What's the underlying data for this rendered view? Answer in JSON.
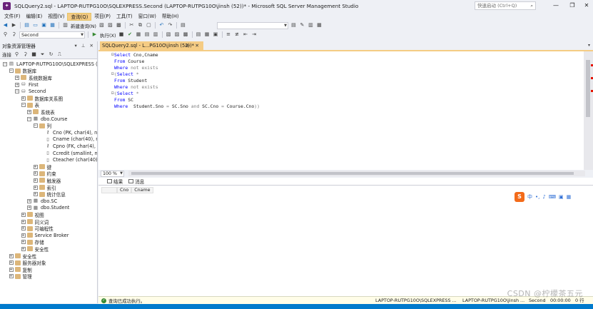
{
  "window": {
    "title": "SQLQuery2.sql - LAPTOP-RUTPG10O\\SQLEXPRESS.Second (LAPTOP-RUTPG10O\\jinsh (52))* - Microsoft SQL Server Management Studio",
    "quick_launch_placeholder": "快速启动 (Ctrl+Q)",
    "controls": {
      "minimize": "—",
      "restore": "❐",
      "close": "✕"
    }
  },
  "menu": [
    "文件(F)",
    "编辑(E)",
    "视图(V)",
    "查询(Q)",
    "项目(P)",
    "工具(T)",
    "窗口(W)",
    "帮助(H)"
  ],
  "toolbar": {
    "new_query": "新建查询(N)",
    "database_select": "Second",
    "execute": "执行(X)"
  },
  "object_explorer": {
    "title": "对象资源管理器",
    "connect": "连接",
    "tree": [
      {
        "label": "LAPTOP-RUTPG10O\\SQLEXPRESS (SC",
        "level": 0,
        "expanded": "−",
        "icon": "server-icon"
      },
      {
        "label": "数据库",
        "level": 1,
        "expanded": "−",
        "icon": "folder-icon"
      },
      {
        "label": "系统数据库",
        "level": 2,
        "expanded": "+",
        "icon": "folder-icon"
      },
      {
        "label": "First",
        "level": 2,
        "expanded": "+",
        "icon": "database-icon"
      },
      {
        "label": "Second",
        "level": 2,
        "expanded": "−",
        "icon": "database-icon"
      },
      {
        "label": "数据库关系图",
        "level": 3,
        "expanded": "+",
        "icon": "folder-icon"
      },
      {
        "label": "表",
        "level": 3,
        "expanded": "−",
        "icon": "folder-icon"
      },
      {
        "label": "系统表",
        "level": 4,
        "expanded": "+",
        "icon": "folder-icon"
      },
      {
        "label": "dbo.Course",
        "level": 4,
        "expanded": "−",
        "icon": "table-icon"
      },
      {
        "label": "列",
        "level": 5,
        "expanded": "−",
        "icon": "folder-icon"
      },
      {
        "label": "Cno (PK, char(4), not",
        "level": 6,
        "expanded": "",
        "icon": "key-icon"
      },
      {
        "label": "Cname (char(40), not",
        "level": 6,
        "expanded": "",
        "icon": "column-icon"
      },
      {
        "label": "Cpno (FK, char(4), null",
        "level": 6,
        "expanded": "",
        "icon": "key-icon"
      },
      {
        "label": "Ccredit (smallint, null",
        "level": 6,
        "expanded": "",
        "icon": "column-icon"
      },
      {
        "label": "Cteacher (char(40), n",
        "level": 6,
        "expanded": "",
        "icon": "column-icon"
      },
      {
        "label": "键",
        "level": 5,
        "expanded": "+",
        "icon": "folder-icon"
      },
      {
        "label": "约束",
        "level": 5,
        "expanded": "+",
        "icon": "folder-icon"
      },
      {
        "label": "触发器",
        "level": 5,
        "expanded": "+",
        "icon": "folder-icon"
      },
      {
        "label": "索引",
        "level": 5,
        "expanded": "+",
        "icon": "folder-icon"
      },
      {
        "label": "统计信息",
        "level": 5,
        "expanded": "+",
        "icon": "folder-icon"
      },
      {
        "label": "dbo.SC",
        "level": 4,
        "expanded": "+",
        "icon": "table-icon"
      },
      {
        "label": "dbo.Student",
        "level": 4,
        "expanded": "+",
        "icon": "table-icon"
      },
      {
        "label": "视图",
        "level": 3,
        "expanded": "+",
        "icon": "folder-icon"
      },
      {
        "label": "同义词",
        "level": 3,
        "expanded": "+",
        "icon": "folder-icon"
      },
      {
        "label": "可编程性",
        "level": 3,
        "expanded": "+",
        "icon": "folder-icon"
      },
      {
        "label": "Service Broker",
        "level": 3,
        "expanded": "+",
        "icon": "folder-icon"
      },
      {
        "label": "存储",
        "level": 3,
        "expanded": "+",
        "icon": "folder-icon"
      },
      {
        "label": "安全性",
        "level": 3,
        "expanded": "+",
        "icon": "folder-icon"
      },
      {
        "label": "安全性",
        "level": 1,
        "expanded": "+",
        "icon": "folder-icon"
      },
      {
        "label": "服务器对象",
        "level": 1,
        "expanded": "+",
        "icon": "folder-icon"
      },
      {
        "label": "复制",
        "level": 1,
        "expanded": "+",
        "icon": "folder-icon"
      },
      {
        "label": "管理",
        "level": 1,
        "expanded": "+",
        "icon": "folder-icon"
      }
    ]
  },
  "editor": {
    "tab_label": "SQLQuery2.sql - L...PG10O\\jinsh (52))*",
    "tab_buttons": "⊕ ✕",
    "lines": [
      [
        {
          "t": "Select ",
          "c": "kw"
        },
        {
          "t": "Cno,Cname",
          "c": ""
        }
      ],
      [
        {
          "t": "From ",
          "c": "kw"
        },
        {
          "t": "Course",
          "c": ""
        }
      ],
      [
        {
          "t": "Where ",
          "c": "kw"
        },
        {
          "t": "not exists",
          "c": "gray"
        }
      ],
      [
        {
          "t": "(",
          "c": "gray"
        },
        {
          "t": "Select ",
          "c": "kw"
        },
        {
          "t": "*",
          "c": "gray"
        }
      ],
      [
        {
          "t": "From ",
          "c": "kw"
        },
        {
          "t": "Student",
          "c": ""
        }
      ],
      [
        {
          "t": "Where ",
          "c": "kw"
        },
        {
          "t": "not exists",
          "c": "gray"
        }
      ],
      [
        {
          "t": "(",
          "c": "gray"
        },
        {
          "t": "Select ",
          "c": "kw"
        },
        {
          "t": "*",
          "c": "gray"
        }
      ],
      [
        {
          "t": "From ",
          "c": "kw"
        },
        {
          "t": "SC",
          "c": ""
        }
      ],
      [
        {
          "t": "Where  ",
          "c": "kw"
        },
        {
          "t": "Student.Sno ",
          "c": ""
        },
        {
          "t": "= ",
          "c": "gray"
        },
        {
          "t": "SC.Sno ",
          "c": ""
        },
        {
          "t": "and ",
          "c": "gray"
        },
        {
          "t": "SC.Cno ",
          "c": ""
        },
        {
          "t": "= ",
          "c": "gray"
        },
        {
          "t": "Course.Cno",
          "c": ""
        },
        {
          "t": "))",
          "c": "gray"
        }
      ],
      [
        {
          "t": "",
          "c": ""
        }
      ]
    ],
    "zoom": "100 %"
  },
  "results": {
    "tabs": [
      "结果",
      "消息"
    ],
    "columns": [
      "Cno",
      "Cname"
    ]
  },
  "ime": {
    "lang": "中"
  },
  "status": {
    "message": "查询已成功执行。",
    "server": "LAPTOP-RUTPG10O\\SQLEXPRESS ...",
    "user": "LAPTOP-RUTPG10O\\jinsh ...",
    "database": "Second",
    "time": "00:00:00",
    "rows": "0 行"
  },
  "watermark": "CSDN @柠檬茶五元"
}
